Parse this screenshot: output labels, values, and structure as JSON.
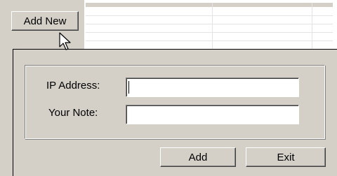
{
  "toolbar": {
    "add_new_label": "Add New"
  },
  "dialog": {
    "ip_address_label": "IP Address:",
    "ip_address_value": "",
    "note_label": "Your Note:",
    "note_value": "",
    "add_label": "Add",
    "exit_label": "Exit"
  },
  "icons": {
    "cursor": "mouse-pointer-icon"
  },
  "colors": {
    "face": "#d4d0c8",
    "window": "#ffffff"
  }
}
